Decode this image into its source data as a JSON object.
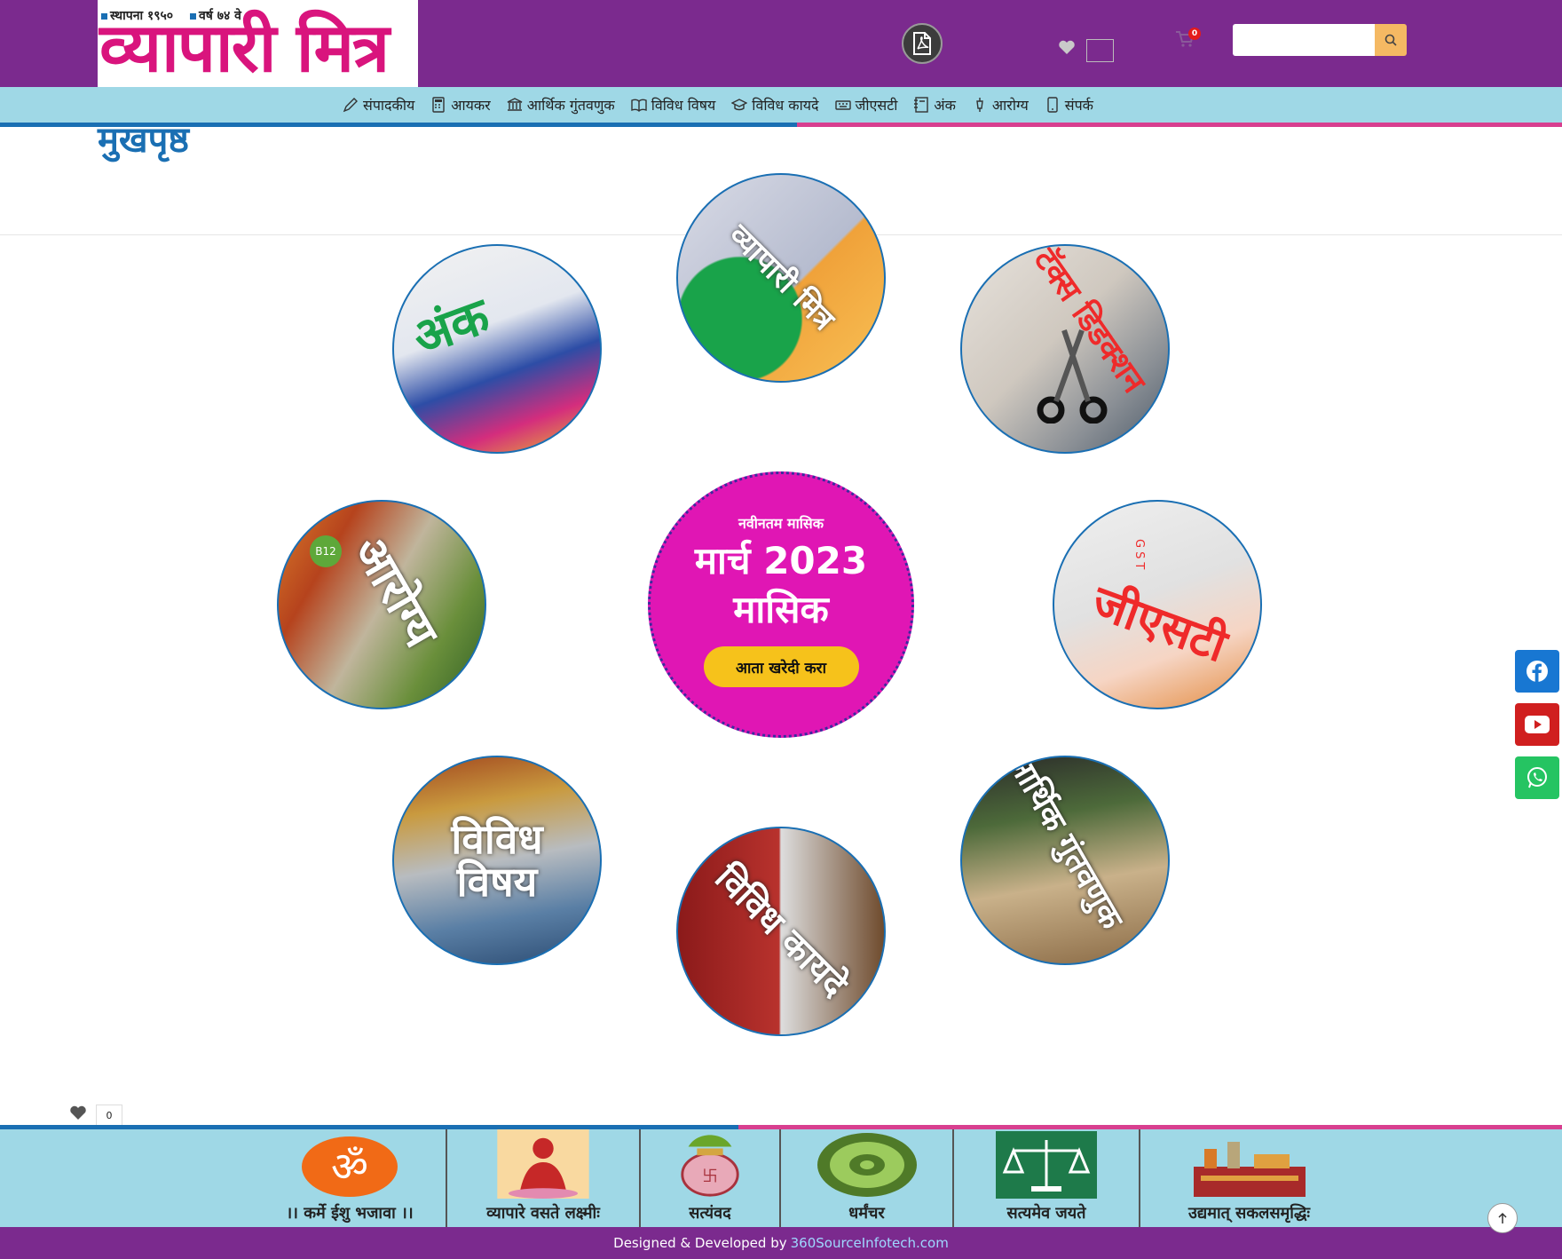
{
  "header": {
    "logo_est_left": "स्थापना १९५०",
    "logo_est_right": "वर्ष ७४ वे",
    "logo_name": "व्यापारी मित्र",
    "cart_count": "0",
    "search_placeholder": ""
  },
  "nav": {
    "items": [
      {
        "label": "संपादकीय",
        "icon": "pencil-icon"
      },
      {
        "label": "आयकर",
        "icon": "calculator-icon"
      },
      {
        "label": "आर्थिक गुंतवणुक",
        "icon": "bank-icon"
      },
      {
        "label": "विविध विषय",
        "icon": "book-open-icon"
      },
      {
        "label": "विविध कायदे",
        "icon": "graduation-cap-icon"
      },
      {
        "label": "जीएसटी",
        "icon": "keyboard-icon"
      },
      {
        "label": "अंक",
        "icon": "journal-icon"
      },
      {
        "label": "आरोग्य",
        "icon": "syringe-icon"
      },
      {
        "label": "संपर्क",
        "icon": "phone-icon"
      }
    ]
  },
  "page": {
    "title": "मुखपृष्ठ"
  },
  "circles": {
    "top": {
      "label": "व्यापारी मित्र"
    },
    "ank": {
      "label": "अंक"
    },
    "tax": {
      "label": "टॅक्स डिडक्शन"
    },
    "health": {
      "label": "आरोग्य",
      "badge": "B12"
    },
    "gst": {
      "label": "जीएसटी",
      "small": "GST"
    },
    "vividh": {
      "label": "विविध\nविषय"
    },
    "kayde": {
      "label": "विविध कायदे"
    },
    "invest": {
      "label": "आर्थिक गुंतवणुक"
    }
  },
  "featured": {
    "kicker": "नवीनतम मासिक",
    "month": "मार्च 2023",
    "sub": "मासिक",
    "button": "आता खरेदी करा"
  },
  "wishlist": {
    "count": "0"
  },
  "mottos": [
    {
      "text": "।। कर्मे ईशु भजावा ।।",
      "icon": "om-icon"
    },
    {
      "text": "व्यापारे वसते लक्ष्मीः",
      "icon": "lakshmi-icon"
    },
    {
      "text": "सत्यंवद",
      "icon": "kalash-icon"
    },
    {
      "text": "धर्मंचर",
      "icon": "dharma-chakra-icon"
    },
    {
      "text": "सत्यमेव जयते",
      "icon": "scales-icon"
    },
    {
      "text": "उद्यमात् सकलसमृद्धिः",
      "icon": "factory-icon"
    }
  ],
  "footer": {
    "credit_prefix": "Designed & Developed by",
    "credit_link": "360SourceInfotech.com"
  },
  "colors": {
    "brand_purple": "#7b2a8e",
    "nav_blue": "#9fd8e6",
    "accent_blue": "#1a6fb3",
    "accent_pink": "#d83f8f",
    "featured_magenta": "#e016b4",
    "buy_yellow": "#f6c21b"
  }
}
